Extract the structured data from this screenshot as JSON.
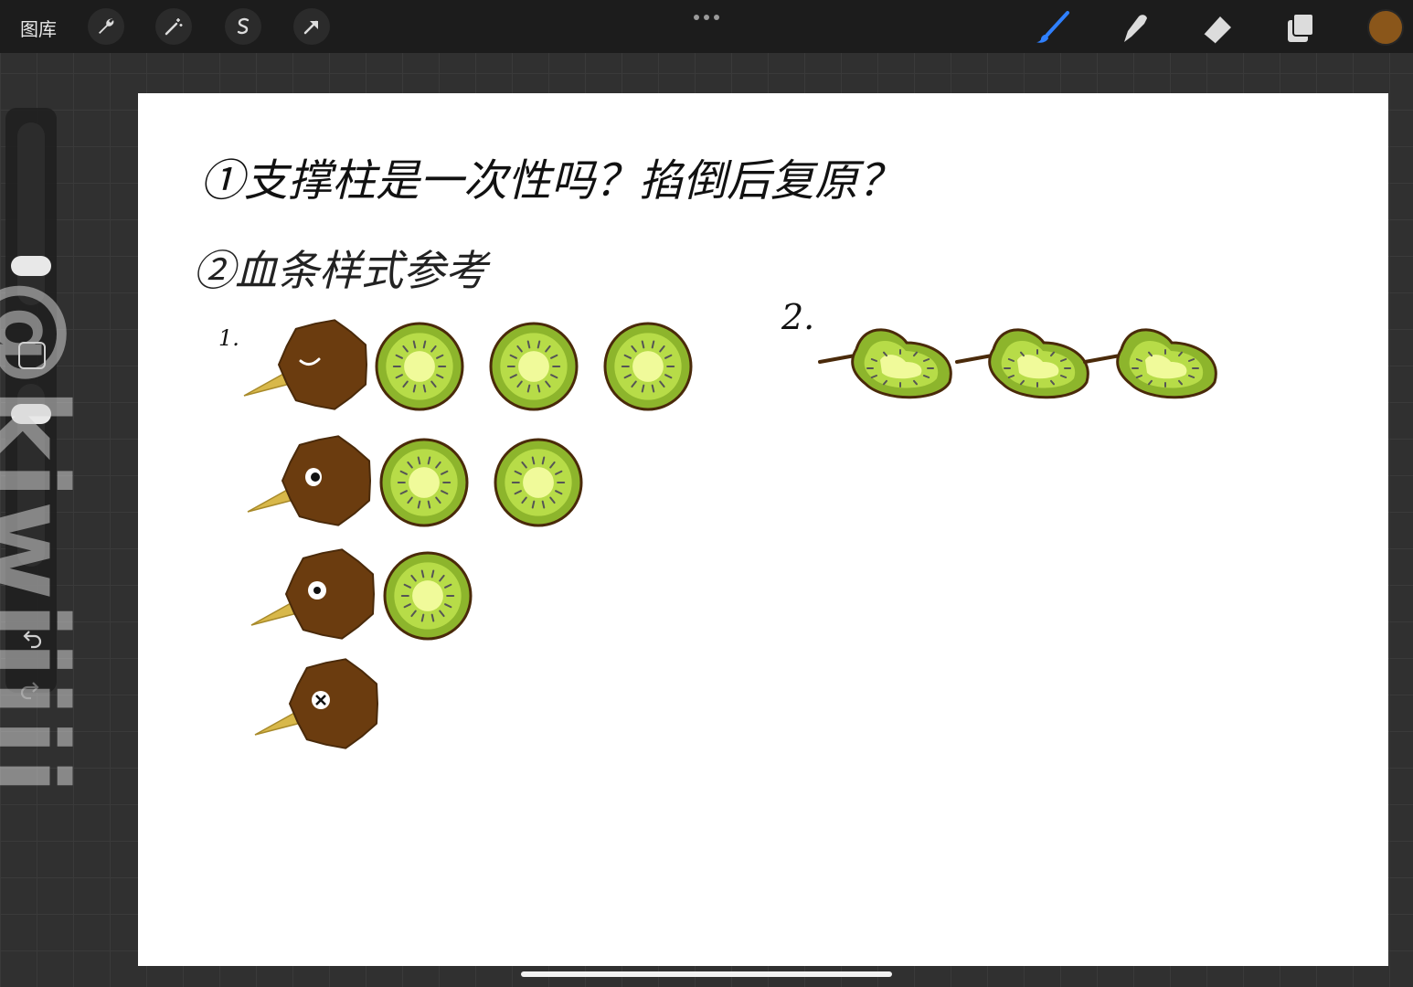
{
  "toolbar": {
    "gallery_label": "图库",
    "left_tools": [
      "wrench-icon",
      "magic-wand-icon",
      "selection-icon",
      "transform-icon"
    ],
    "more_icon": "more-dots-icon",
    "right_tools": [
      "brush-icon",
      "smudge-icon",
      "eraser-icon",
      "layers-icon"
    ],
    "current_color": "#8a561a"
  },
  "sidebar": {
    "controls": [
      "brush-size-slider",
      "modify-button",
      "opacity-slider",
      "undo-icon",
      "redo-icon"
    ]
  },
  "watermark": {
    "text": "@kiwiiiii"
  },
  "canvas": {
    "line1": "①支撑柱是一次性吗？掐倒后复原？",
    "line2": "②血条样式参考",
    "label1": "1.",
    "label2": "2."
  },
  "colors": {
    "kiwi_brown": "#6b3c0f",
    "kiwi_outline": "#4a2a0a",
    "beak": "#d8b84a",
    "fruit_skin": "#8db52c",
    "fruit_flesh": "#b7dc48",
    "fruit_core": "#f0fa9a"
  },
  "health_bar_style_1": {
    "rows": [
      {
        "eye": "closed",
        "slices": 3
      },
      {
        "eye": "open",
        "slices": 2
      },
      {
        "eye": "wide",
        "slices": 1
      },
      {
        "eye": "x",
        "slices": 0
      }
    ]
  },
  "health_bar_style_2": {
    "kiwi_pieces": 3
  }
}
